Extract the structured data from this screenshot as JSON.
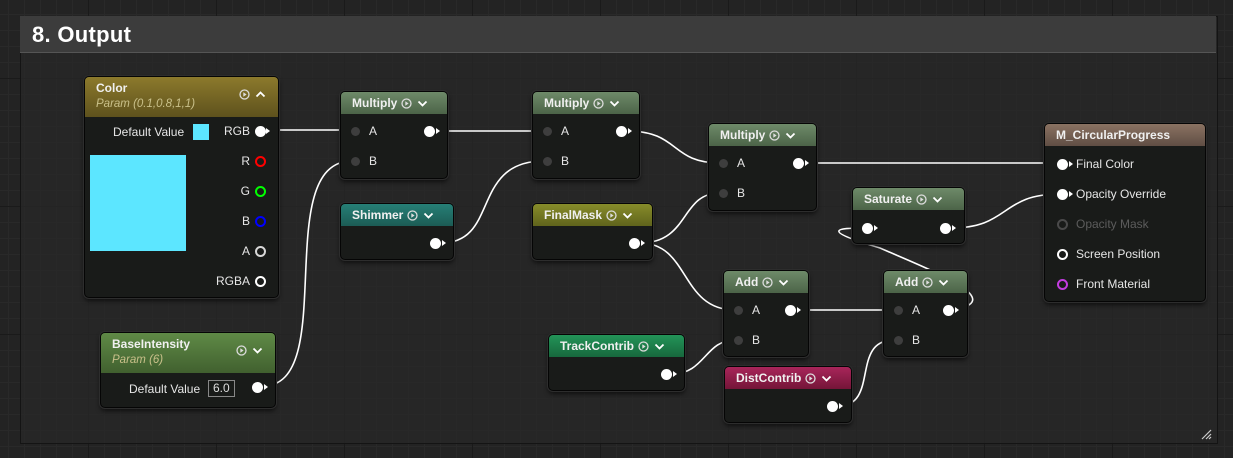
{
  "comment": {
    "title": "8. Output"
  },
  "colors": {
    "wire": "#ffffff",
    "color_value": "#5ce6ff",
    "pin_r": "#ff0000",
    "pin_g": "#00ff00",
    "pin_b": "#0000ff",
    "front_material": "#c33ce0"
  },
  "nodes": {
    "color": {
      "title": "Color",
      "subtitle": "Param (0.1,0.8,1,1)",
      "default_label": "Default Value",
      "outputs": [
        "RGB",
        "R",
        "G",
        "B",
        "A",
        "RGBA"
      ]
    },
    "base_intensity": {
      "title": "BaseIntensity",
      "subtitle": "Param (6)",
      "default_label": "Default Value",
      "default_value": "6.0"
    },
    "multiply1": {
      "title": "Multiply",
      "in_a": "A",
      "in_b": "B"
    },
    "multiply2": {
      "title": "Multiply",
      "in_a": "A",
      "in_b": "B"
    },
    "multiply3": {
      "title": "Multiply",
      "in_a": "A",
      "in_b": "B"
    },
    "shimmer": {
      "title": "Shimmer"
    },
    "finalmask": {
      "title": "FinalMask"
    },
    "saturate": {
      "title": "Saturate"
    },
    "add1": {
      "title": "Add",
      "in_a": "A",
      "in_b": "B"
    },
    "add2": {
      "title": "Add",
      "in_a": "A",
      "in_b": "B"
    },
    "trackcontrib": {
      "title": "TrackContrib"
    },
    "distcontrib": {
      "title": "DistContrib"
    },
    "result": {
      "title": "M_CircularProgress",
      "inputs": [
        "Final Color",
        "Opacity Override",
        "Opacity Mask",
        "Screen Position",
        "Front Material"
      ]
    }
  }
}
